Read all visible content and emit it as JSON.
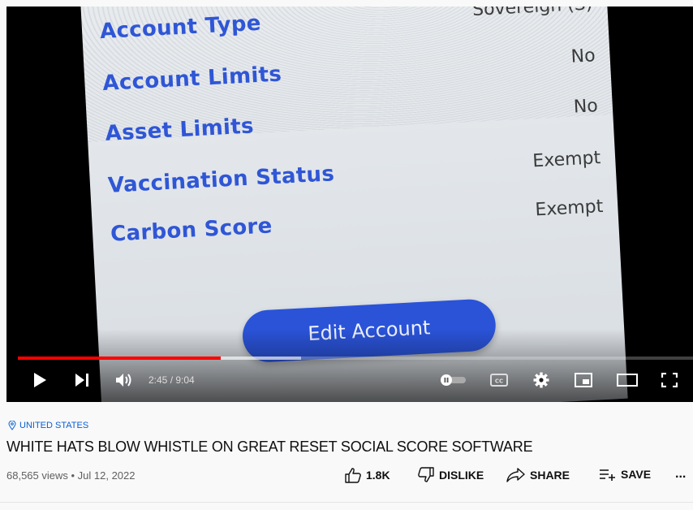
{
  "video": {
    "screen_rows": [
      {
        "label": "Account Type",
        "value": "Sovereign (S)"
      },
      {
        "label": "Account Limits",
        "value": "No"
      },
      {
        "label": "Asset Limits",
        "value": "No"
      },
      {
        "label": "Vaccination Status",
        "value": "Exempt"
      },
      {
        "label": "Carbon Score",
        "value": "Exempt"
      }
    ],
    "screen_button": "Edit Account",
    "progress_fraction": 0.301,
    "buffered_fraction": 0.42
  },
  "player": {
    "time": "2:45 / 9:04",
    "icons": {
      "play": "play-icon",
      "next": "next-icon",
      "volume": "volume-icon",
      "autoplay": "autoplay-toggle-icon",
      "captions": "cc-icon",
      "settings": "gear-icon",
      "miniplayer": "miniplayer-icon",
      "theater": "theater-icon",
      "fullscreen": "fullscreen-icon"
    },
    "accent_color": "#ff0000"
  },
  "info": {
    "location": "UNITED STATES",
    "title": "WHITE HATS BLOW WHISTLE ON GREAT RESET SOCIAL SCORE SOFTWARE",
    "meta": "68,565 views • Jul 12, 2022",
    "actions": {
      "like": "1.8K",
      "dislike": "DISLIKE",
      "share": "SHARE",
      "save": "SAVE",
      "more": "..."
    }
  }
}
